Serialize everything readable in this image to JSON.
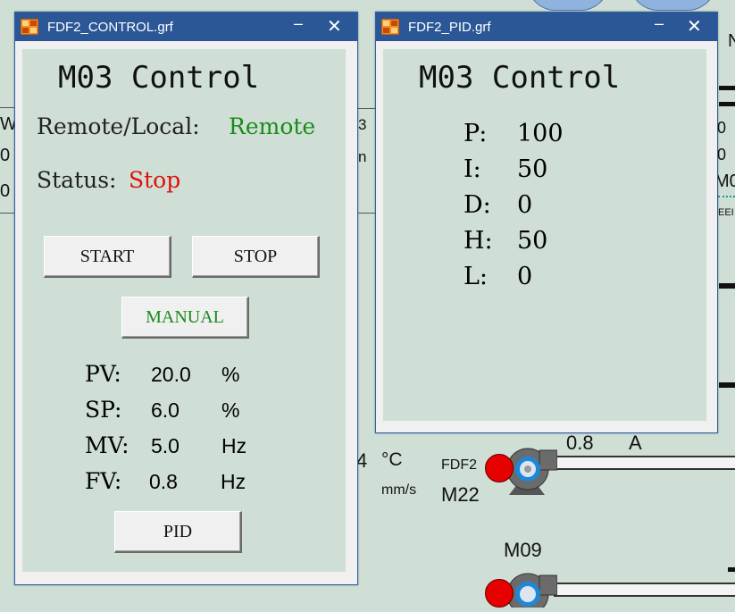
{
  "background": {
    "left_fragments": [
      "W",
      "0",
      "0"
    ],
    "mid_fragments": [
      "3",
      "n"
    ],
    "right_fragments": [
      "0",
      "0",
      "M0",
      "EEI"
    ],
    "right_top_label": "N",
    "temp_value": "4",
    "temp_unit": "°C",
    "speed_unit": "mm/s",
    "pump_fdf2": {
      "tag": "FDF2",
      "name": "M22",
      "value": "0.8",
      "unit": "A"
    },
    "pump_m09": {
      "name": "M09"
    }
  },
  "control_window": {
    "title": "FDF2_CONTROL.grf",
    "minimize": "–",
    "close": "✕",
    "heading": "M03 Control",
    "remote_label": "Remote/Local:",
    "remote_value": "Remote",
    "status_label": "Status:",
    "status_value": "Stop",
    "buttons": {
      "start": "START",
      "stop": "STOP",
      "manual": "MANUAL",
      "pid": "PID"
    },
    "readings": [
      {
        "label": "PV:",
        "value": "20.0",
        "unit": "%"
      },
      {
        "label": "SP:",
        "value": "6.0",
        "unit": "%"
      },
      {
        "label": "MV:",
        "value": "5.0",
        "unit": "Hz"
      },
      {
        "label": "FV:",
        "value": "0.8",
        "unit": "Hz"
      }
    ]
  },
  "pid_window": {
    "title": "FDF2_PID.grf",
    "minimize": "–",
    "close": "✕",
    "heading": "M03 Control",
    "params": [
      {
        "label": "P:",
        "value": "100"
      },
      {
        "label": "I:",
        "value": "50"
      },
      {
        "label": "D:",
        "value": "0"
      },
      {
        "label": "H:",
        "value": "50"
      },
      {
        "label": "L:",
        "value": "0"
      }
    ]
  },
  "colors": {
    "remote": "#1a8a1a",
    "stop": "#e01010",
    "manual": "#1a8a1a",
    "titlebar": "#2b5797",
    "panel": "#cfdfd5"
  },
  "icons": [
    "app-grid-icon",
    "minimize-icon",
    "close-icon",
    "pump-icon"
  ]
}
